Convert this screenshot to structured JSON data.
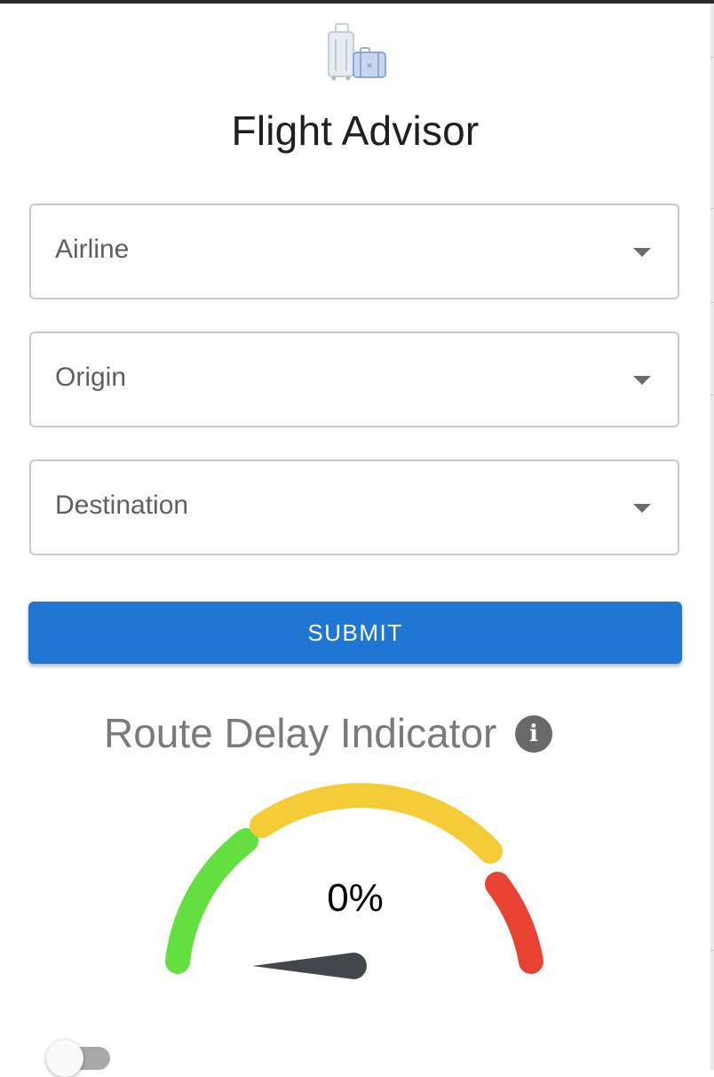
{
  "app": {
    "title": "Flight Advisor",
    "logo_icon": "luggage-icon"
  },
  "form": {
    "airline_label": "Airline",
    "origin_label": "Origin",
    "destination_label": "Destination",
    "submit_label": "SUBMIT"
  },
  "gauge": {
    "title": "Route Delay Indicator",
    "value_text": "0%",
    "value": 0,
    "info_icon": "info-icon",
    "info_glyph": "i",
    "segments": [
      {
        "name": "low",
        "color": "#63e03f"
      },
      {
        "name": "medium",
        "color": "#f4cc37"
      },
      {
        "name": "high",
        "color": "#e84232"
      }
    ],
    "needle_color": "#43464b"
  },
  "toggle": {
    "checked": false
  },
  "colors": {
    "accent": "#1f76d3",
    "text": "#1f1f1f",
    "muted": "#7a7a7a"
  }
}
